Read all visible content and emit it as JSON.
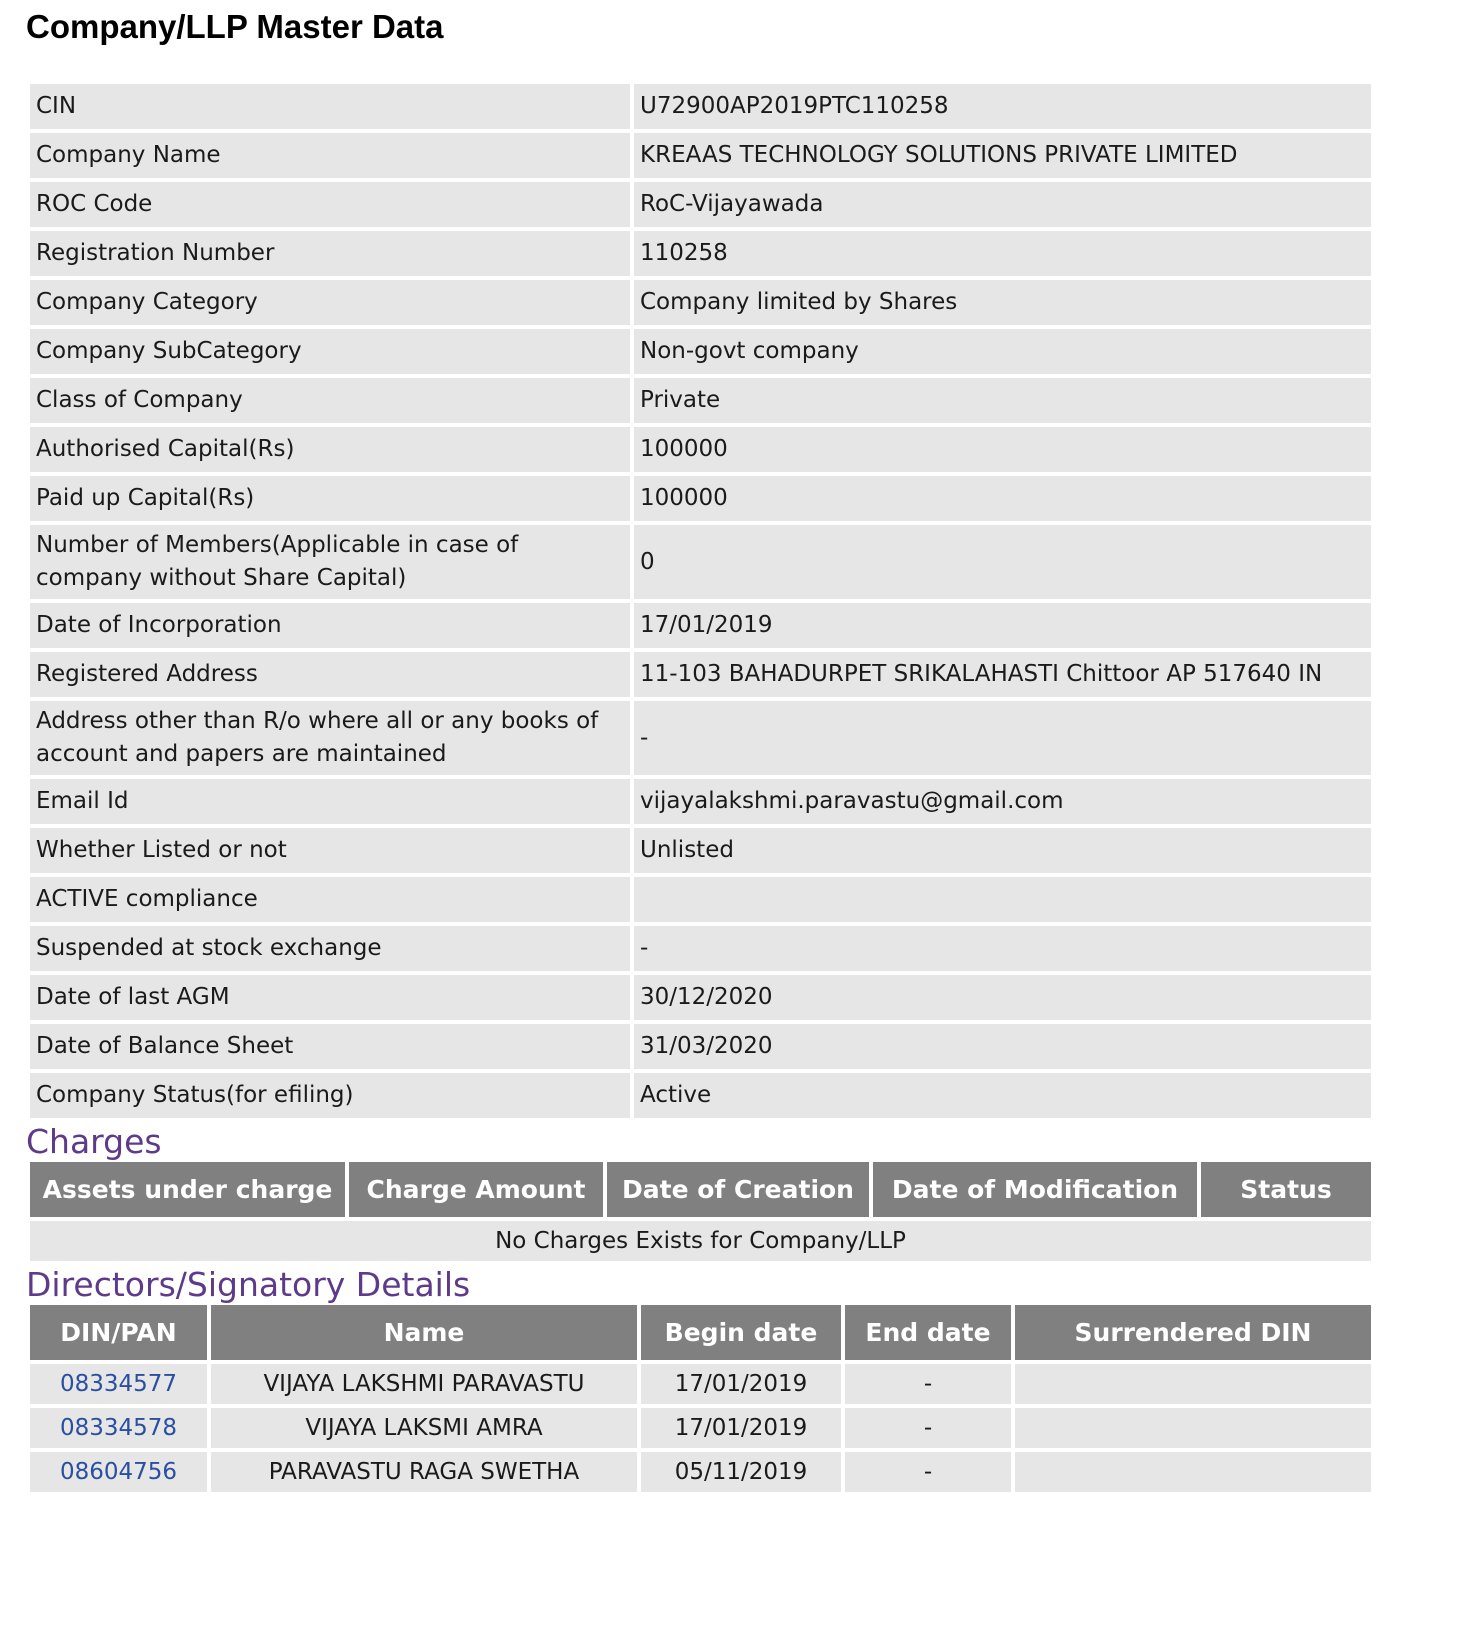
{
  "page_title": "Company/LLP Master Data",
  "master_rows": [
    {
      "label": "CIN",
      "value": "U72900AP2019PTC110258"
    },
    {
      "label": "Company Name",
      "value": "KREAAS TECHNOLOGY SOLUTIONS PRIVATE LIMITED"
    },
    {
      "label": "ROC Code",
      "value": "RoC-Vijayawada"
    },
    {
      "label": "Registration Number",
      "value": "110258"
    },
    {
      "label": "Company Category",
      "value": "Company limited by Shares"
    },
    {
      "label": "Company SubCategory",
      "value": "Non-govt company"
    },
    {
      "label": "Class of Company",
      "value": "Private"
    },
    {
      "label": "Authorised Capital(Rs)",
      "value": "100000"
    },
    {
      "label": "Paid up Capital(Rs)",
      "value": "100000"
    },
    {
      "label": "Number of Members(Applicable in case of company without Share Capital)",
      "value": "0"
    },
    {
      "label": "Date of Incorporation",
      "value": "17/01/2019"
    },
    {
      "label": "Registered Address",
      "value": "11-103 BAHADURPET SRIKALAHASTI Chittoor AP 517640 IN"
    },
    {
      "label": "Address other than R/o where all or any books of account and papers are maintained",
      "value": "-"
    },
    {
      "label": "Email Id",
      "value": "vijayalakshmi.paravastu@gmail.com"
    },
    {
      "label": "Whether Listed or not",
      "value": "Unlisted"
    },
    {
      "label": "ACTIVE compliance",
      "value": ""
    },
    {
      "label": "Suspended at stock exchange",
      "value": "-"
    },
    {
      "label": "Date of last AGM",
      "value": "30/12/2020"
    },
    {
      "label": "Date of Balance Sheet",
      "value": "31/03/2020"
    },
    {
      "label": "Company Status(for efiling)",
      "value": "Active"
    }
  ],
  "charges": {
    "title": "Charges",
    "headers": [
      "Assets under charge",
      "Charge Amount",
      "Date of Creation",
      "Date of Modification",
      "Status"
    ],
    "empty_message": "No Charges Exists for Company/LLP"
  },
  "directors": {
    "title": "Directors/Signatory Details",
    "headers": [
      "DIN/PAN",
      "Name",
      "Begin date",
      "End date",
      "Surrendered DIN"
    ],
    "rows": [
      {
        "din": "08334577",
        "name": "VIJAYA LAKSHMI PARAVASTU",
        "begin": "17/01/2019",
        "end": "-",
        "surrendered": ""
      },
      {
        "din": "08334578",
        "name": "VIJAYA LAKSMI AMRA",
        "begin": "17/01/2019",
        "end": "-",
        "surrendered": ""
      },
      {
        "din": "08604756",
        "name": "PARAVASTU RAGA SWETHA",
        "begin": "05/11/2019",
        "end": "-",
        "surrendered": ""
      }
    ]
  },
  "colors": {
    "section_title": "#5e3b8a",
    "header_bg": "#808080",
    "cell_bg": "#e6e6e6",
    "link": "#2a4fa0"
  }
}
